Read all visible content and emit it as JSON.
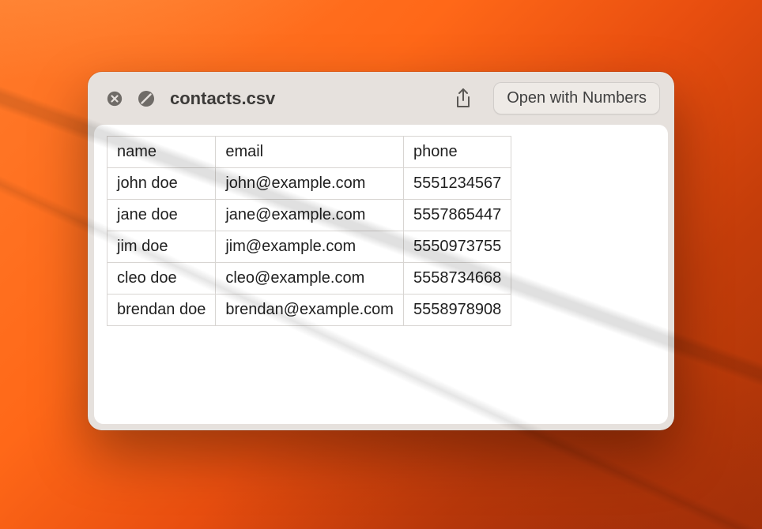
{
  "window": {
    "title": "contacts.csv",
    "open_button_label": "Open with Numbers"
  },
  "table": {
    "headers": [
      "name",
      "email",
      "phone"
    ],
    "rows": [
      {
        "name": "john doe",
        "email": "john@example.com",
        "phone": "5551234567"
      },
      {
        "name": "jane doe",
        "email": "jane@example.com",
        "phone": "5557865447"
      },
      {
        "name": "jim doe",
        "email": "jim@example.com",
        "phone": "5550973755"
      },
      {
        "name": "cleo doe",
        "email": "cleo@example.com",
        "phone": "5558734668"
      },
      {
        "name": "brendan doe",
        "email": "brendan@example.com",
        "phone": "5558978908"
      }
    ]
  }
}
